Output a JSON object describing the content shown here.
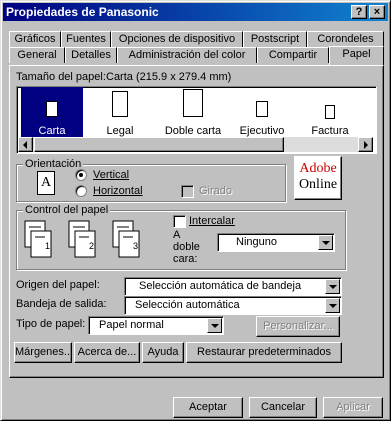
{
  "window": {
    "title": "Propiedades de Panasonic",
    "help_label": "?",
    "close_label": "×"
  },
  "tabs_row1": [
    "Gráficos",
    "Fuentes",
    "Opciones de dispositivo",
    "Postscript",
    "Corondeles"
  ],
  "tabs_row2": [
    "General",
    "Detalles",
    "Administración del color",
    "Compartir",
    "Papel"
  ],
  "active_tab": "Papel",
  "paper_size": {
    "label": "Tamaño del papel:",
    "value": "Carta (215.9 x 279.4 mm)",
    "items": [
      "Carta",
      "Legal",
      "Doble carta",
      "Ejecutivo",
      "Factura"
    ],
    "selected": "Carta"
  },
  "orientation": {
    "group_title": "Orientación",
    "vertical_label": "Vertical",
    "horizontal_label": "Horizontal",
    "rotated_label": "Girado",
    "selected": "Vertical",
    "sample_glyph": "A"
  },
  "adobe": {
    "line1": "Adobe",
    "line2": "Online"
  },
  "paper_control": {
    "group_title": "Control del papel",
    "collate_label": "Intercalar",
    "duplex_label": "A doble cara:",
    "duplex_value": "Ninguno",
    "page_numbers": [
      "1",
      "2",
      "3"
    ]
  },
  "paper_source": {
    "label": "Origen del papel:",
    "value": "Selección automática de bandeja"
  },
  "output_tray": {
    "label": "Bandeja de salida:",
    "value": "Selección automática"
  },
  "paper_type": {
    "label": "Tipo de papel:",
    "value": "Papel normal",
    "customize_label": "Personalizar..."
  },
  "panel_buttons": {
    "margins": "Márgenes...",
    "about": "Acerca de...",
    "help": "Ayuda",
    "restore": "Restaurar predeterminados"
  },
  "dialog_buttons": {
    "ok": "Aceptar",
    "cancel": "Cancelar",
    "apply": "Aplicar"
  },
  "colors": {
    "titlebar": "#000080",
    "selection": "#000080",
    "adobe_red": "#cc0000"
  }
}
